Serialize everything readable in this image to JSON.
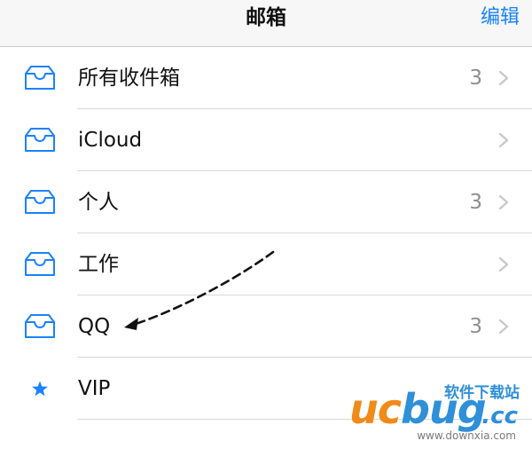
{
  "navbar": {
    "title": "邮箱",
    "edit_label": "编辑"
  },
  "mailboxes": [
    {
      "icon": "inbox-icon",
      "label": "所有收件箱",
      "count": "3",
      "chevron": true
    },
    {
      "icon": "inbox-icon",
      "label": "iCloud",
      "count": "",
      "chevron": true
    },
    {
      "icon": "inbox-icon",
      "label": "个人",
      "count": "3",
      "chevron": true
    },
    {
      "icon": "inbox-icon",
      "label": "工作",
      "count": "",
      "chevron": true
    },
    {
      "icon": "inbox-icon",
      "label": "QQ",
      "count": "3",
      "chevron": true
    },
    {
      "icon": "star-icon",
      "label": "VIP",
      "count": "",
      "chevron": false
    }
  ],
  "watermark": {
    "brand_u": "uc",
    "brand_b": "bug",
    "brand_cc": ".cc",
    "cn_text": "软件下载站",
    "url": "www.downxia.com"
  },
  "colors": {
    "accent": "#1a82fb",
    "count": "#8e8e93",
    "chevron": "#c7c7cc",
    "separator": "#d9d9de",
    "watermark_orange": "#f08a18",
    "watermark_blue": "#2f8fd8"
  }
}
